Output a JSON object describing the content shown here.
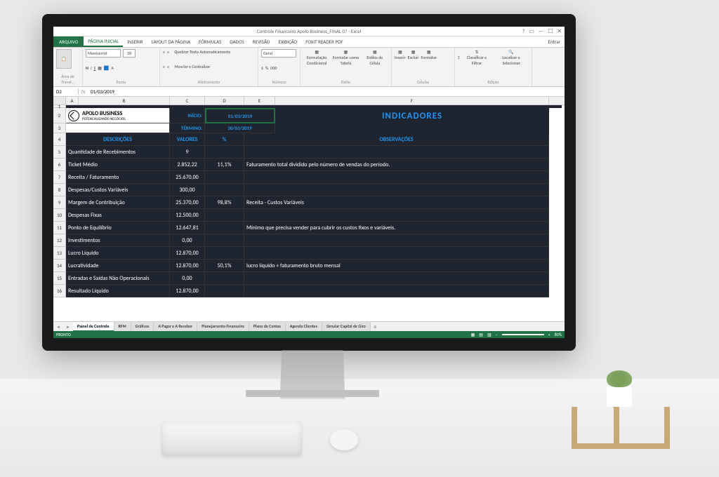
{
  "title": "Controle Financeiro Apolo Business_FINAL 07 - Excel",
  "signin": "Entrar",
  "file_tab": "ARQUIVO",
  "ribbon_tabs": [
    "PÁGINA INICIAL",
    "INSERIR",
    "LAYOUT DA PÁGINA",
    "FÓRMULAS",
    "DADOS",
    "REVISÃO",
    "EXIBIÇÃO",
    "FOXIT READER PDF"
  ],
  "ribbon": {
    "font_name": "Montserrat",
    "font_size": "18",
    "wrap": "Quebrar Texto Automaticamente",
    "merge": "Mesclar e Centralizar",
    "number_format": "Geral",
    "cond_format": "Formatação Condicional",
    "format_table": "Formatar como Tabela",
    "cell_styles": "Estilos de Célula",
    "insert": "Inserir",
    "delete": "Excluir",
    "format": "Formatar",
    "sort_filter": "Classificar e Filtrar",
    "find_select": "Localizar e Selecionar",
    "groups": {
      "clipboard": "Área de Transf…",
      "font": "Fonte",
      "alignment": "Alinhamento",
      "number": "Número",
      "style": "Estilo",
      "cells": "Células",
      "editing": "Edição"
    }
  },
  "namebox": "D2",
  "fx": "fx",
  "formula": "01/03/2019",
  "cols": [
    "A",
    "B",
    "C",
    "D",
    "E",
    "F"
  ],
  "logo": {
    "line1": "APOLO BUSINESS",
    "line2": "POTENCIALIZANDO NEGÓCIOS"
  },
  "dates": {
    "start_label": "INÍCIO:",
    "end_label": "TÉRMINO:",
    "start": "01/03/2019",
    "end": "30/03/2019"
  },
  "main_title": "INDICADORES",
  "headers": {
    "desc": "DESCRIÇÕES",
    "val": "VALORES",
    "pct": "%",
    "obs": "OBSERVAÇÕES"
  },
  "rows": [
    {
      "n": "5",
      "desc": "Quantidade de Recebimentos",
      "val": "9",
      "pct": "",
      "obs": ""
    },
    {
      "n": "6",
      "desc": "Ticket Médio",
      "val": "2.852,22",
      "pct": "11,1%",
      "obs": "Faturamento total dividido pelo número de vendas do período."
    },
    {
      "n": "7",
      "desc": "Receita / Faturamento",
      "val": "25.670,00",
      "pct": "",
      "obs": ""
    },
    {
      "n": "8",
      "desc": "Despesas/Custos Variáveis",
      "val": "300,00",
      "pct": "",
      "obs": ""
    },
    {
      "n": "9",
      "desc": "Margem de Contribuição",
      "val": "25.370,00",
      "pct": "98,8%",
      "obs": "Receita - Custos Variáveis"
    },
    {
      "n": "10",
      "desc": "Despesas Fixas",
      "val": "12.500,00",
      "pct": "",
      "obs": ""
    },
    {
      "n": "11",
      "desc": "Ponto de Equilíbrio",
      "val": "12.647,81",
      "pct": "",
      "obs": "Mínimo que precisa vender para cubrir os custos fixos e variáveis."
    },
    {
      "n": "12",
      "desc": "Investimentos",
      "val": "0,00",
      "pct": "",
      "obs": ""
    },
    {
      "n": "13",
      "desc": "Lucro Líquido",
      "val": "12.870,00",
      "pct": "",
      "obs": ""
    },
    {
      "n": "14",
      "desc": "Lucratividade",
      "val": "12.870,00",
      "pct": "50,1%",
      "obs": "lucro líquido ÷ faturamento bruto mensal"
    },
    {
      "n": "15",
      "desc": "Entradas e Saídas Não Operacionais",
      "val": "0,00",
      "pct": "",
      "obs": ""
    },
    {
      "n": "16",
      "desc": "Resultado Líquido",
      "val": "12.870,00",
      "pct": "",
      "obs": ""
    }
  ],
  "sheet_tabs": [
    "Painel de Controle",
    "RFM",
    "Gráficos",
    "A Pagar e A Receber",
    "Planejamento Financeiro",
    "Plano de Contas",
    "Agenda Clientes",
    "Simular Capital de Giro"
  ],
  "status": "PRONTO",
  "zoom": "80%"
}
